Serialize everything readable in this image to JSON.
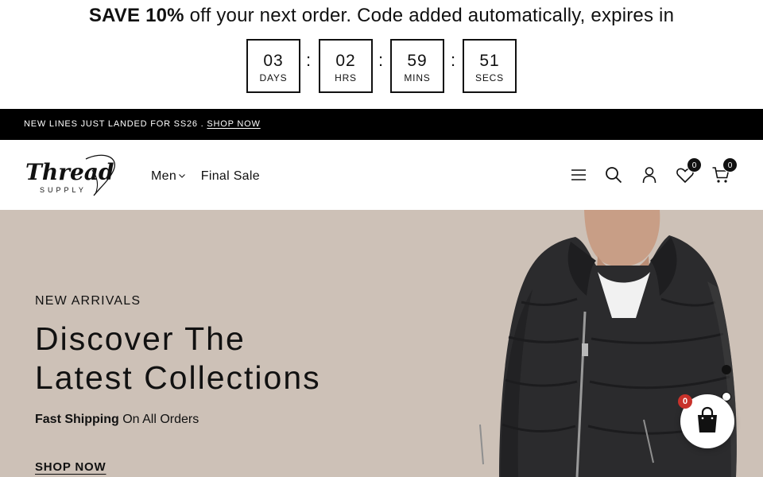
{
  "promo": {
    "bold": "SAVE 10%",
    "text": " off your next order. Code added automatically, expires in",
    "countdown": [
      {
        "value": "03",
        "label": "DAYS"
      },
      {
        "value": "02",
        "label": "HRS"
      },
      {
        "value": "59",
        "label": "MINS"
      },
      {
        "value": "51",
        "label": "SECS"
      }
    ],
    "separator": ":"
  },
  "announcement": {
    "text": "NEW LINES JUST LANDED FOR SS26 . ",
    "link": "SHOP NOW"
  },
  "header": {
    "logo": {
      "line1": "Thread",
      "line2": "SUPPLY"
    },
    "nav": [
      {
        "label": "Men",
        "dropdown": true
      },
      {
        "label": "Final Sale",
        "dropdown": false
      }
    ],
    "icons": [
      "menu-icon",
      "search-icon",
      "account-icon",
      "wishlist-icon",
      "cart-icon"
    ],
    "wishlist_count": "0",
    "cart_count": "0"
  },
  "hero": {
    "eyebrow": "NEW ARRIVALS",
    "headline_1": "Discover The",
    "headline_2": "Latest Collections",
    "sub_bold": "Fast Shipping",
    "sub_rest": " On All Orders",
    "cta": "SHOP NOW",
    "slides": 2,
    "active_slide": 1,
    "background_color": "#cdc1b7"
  },
  "floating_cart": {
    "count": "0",
    "badge_color": "#c8322b"
  }
}
